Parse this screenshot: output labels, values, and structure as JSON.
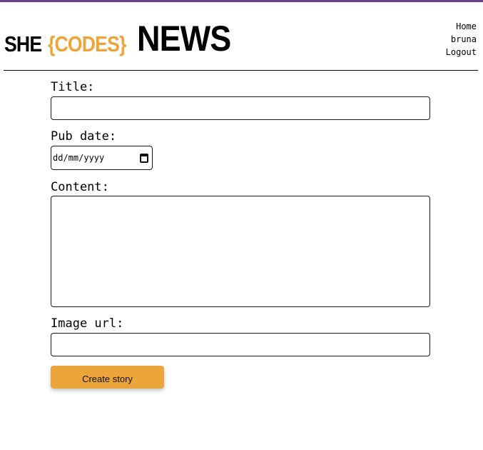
{
  "brand": {
    "part1": "SHE",
    "part2": "{CODES}",
    "part3": "NEWS",
    "accent_color": "#eba53a",
    "top_strip_color": "#6a3f8f"
  },
  "nav": {
    "items": [
      {
        "label": "Home"
      },
      {
        "label": "bruna"
      },
      {
        "label": "Logout"
      }
    ]
  },
  "form": {
    "title_label": "Title:",
    "title_value": "",
    "pub_date_label": "Pub date:",
    "pub_date_placeholder": "dd/mm/yyyy",
    "calendar_icon": "calendar-icon",
    "content_label": "Content:",
    "content_value": "",
    "image_url_label": "Image url:",
    "image_url_value": "",
    "submit_label": "Create story"
  }
}
